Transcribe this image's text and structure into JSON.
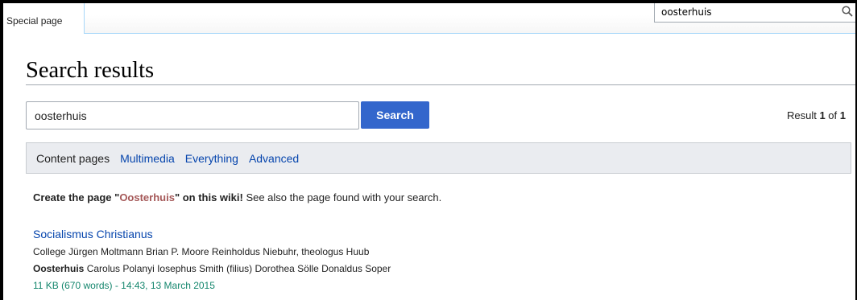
{
  "tabs": {
    "special": "Special page"
  },
  "header_search": {
    "value": "oosterhuis"
  },
  "page_title": "Search results",
  "search": {
    "value": "oosterhuis",
    "button_label": "Search",
    "result_prefix": "Result ",
    "result_from": "1",
    "result_of": " of ",
    "result_total": "1"
  },
  "profiles": {
    "current": "Content pages",
    "links": [
      "Multimedia",
      "Everything",
      "Advanced"
    ]
  },
  "create_notice": {
    "prefix": "Create the page \"",
    "title": "Oosterhuis",
    "suffix": "\" on this wiki!",
    "note": " See also the page found with your search."
  },
  "results": [
    {
      "title": "Socialismus Christianus",
      "snippet_line1": "College Jürgen Moltmann Brian P. Moore Reinholdus Niebuhr, theologus Huub",
      "snippet_line2_match": "Oosterhuis",
      "snippet_line2_rest": " Carolus Polanyi Iosephus Smith (filius) Dorothea Sölle Donaldus Soper",
      "meta": "11 KB (670 words) - 14:43, 13 March 2015"
    }
  ],
  "colors": {
    "link": "#0645ad",
    "redlink": "#a55858",
    "button": "#3366cc",
    "meta": "#14866d"
  },
  "icons": {
    "header_search": "search-icon"
  }
}
